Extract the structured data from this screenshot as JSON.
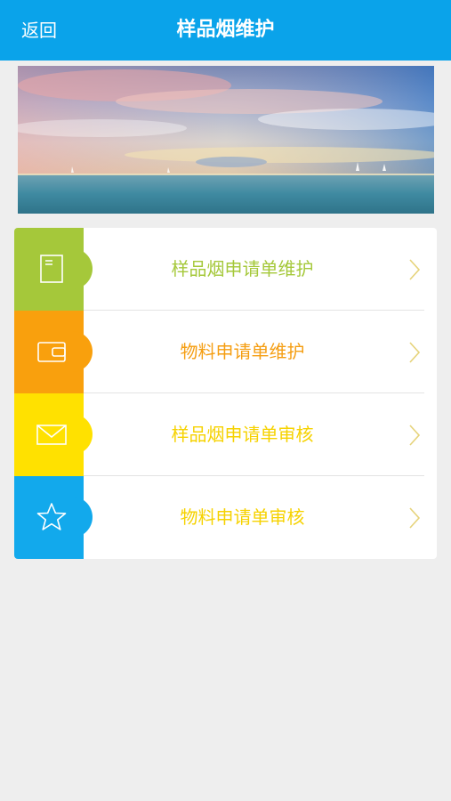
{
  "header": {
    "back_label": "返回",
    "title": "样品烟维护"
  },
  "banner": {
    "image": "sea-sunset-banner"
  },
  "menu": {
    "items": [
      {
        "label": "样品烟申请单维护",
        "icon": "document-icon",
        "tile_color": "#a5c83a",
        "text_color": "#a5c83a"
      },
      {
        "label": "物料申请单维护",
        "icon": "wallet-icon",
        "tile_color": "#f9a00d",
        "text_color": "#f59e12"
      },
      {
        "label": "样品烟申请单审核",
        "icon": "envelope-icon",
        "tile_color": "#ffe100",
        "text_color": "#f6d200"
      },
      {
        "label": "物料申请单审核",
        "icon": "star-icon",
        "tile_color": "#12a9ec",
        "text_color": "#f6d200"
      }
    ],
    "chevron_color": "#e6d37a"
  }
}
